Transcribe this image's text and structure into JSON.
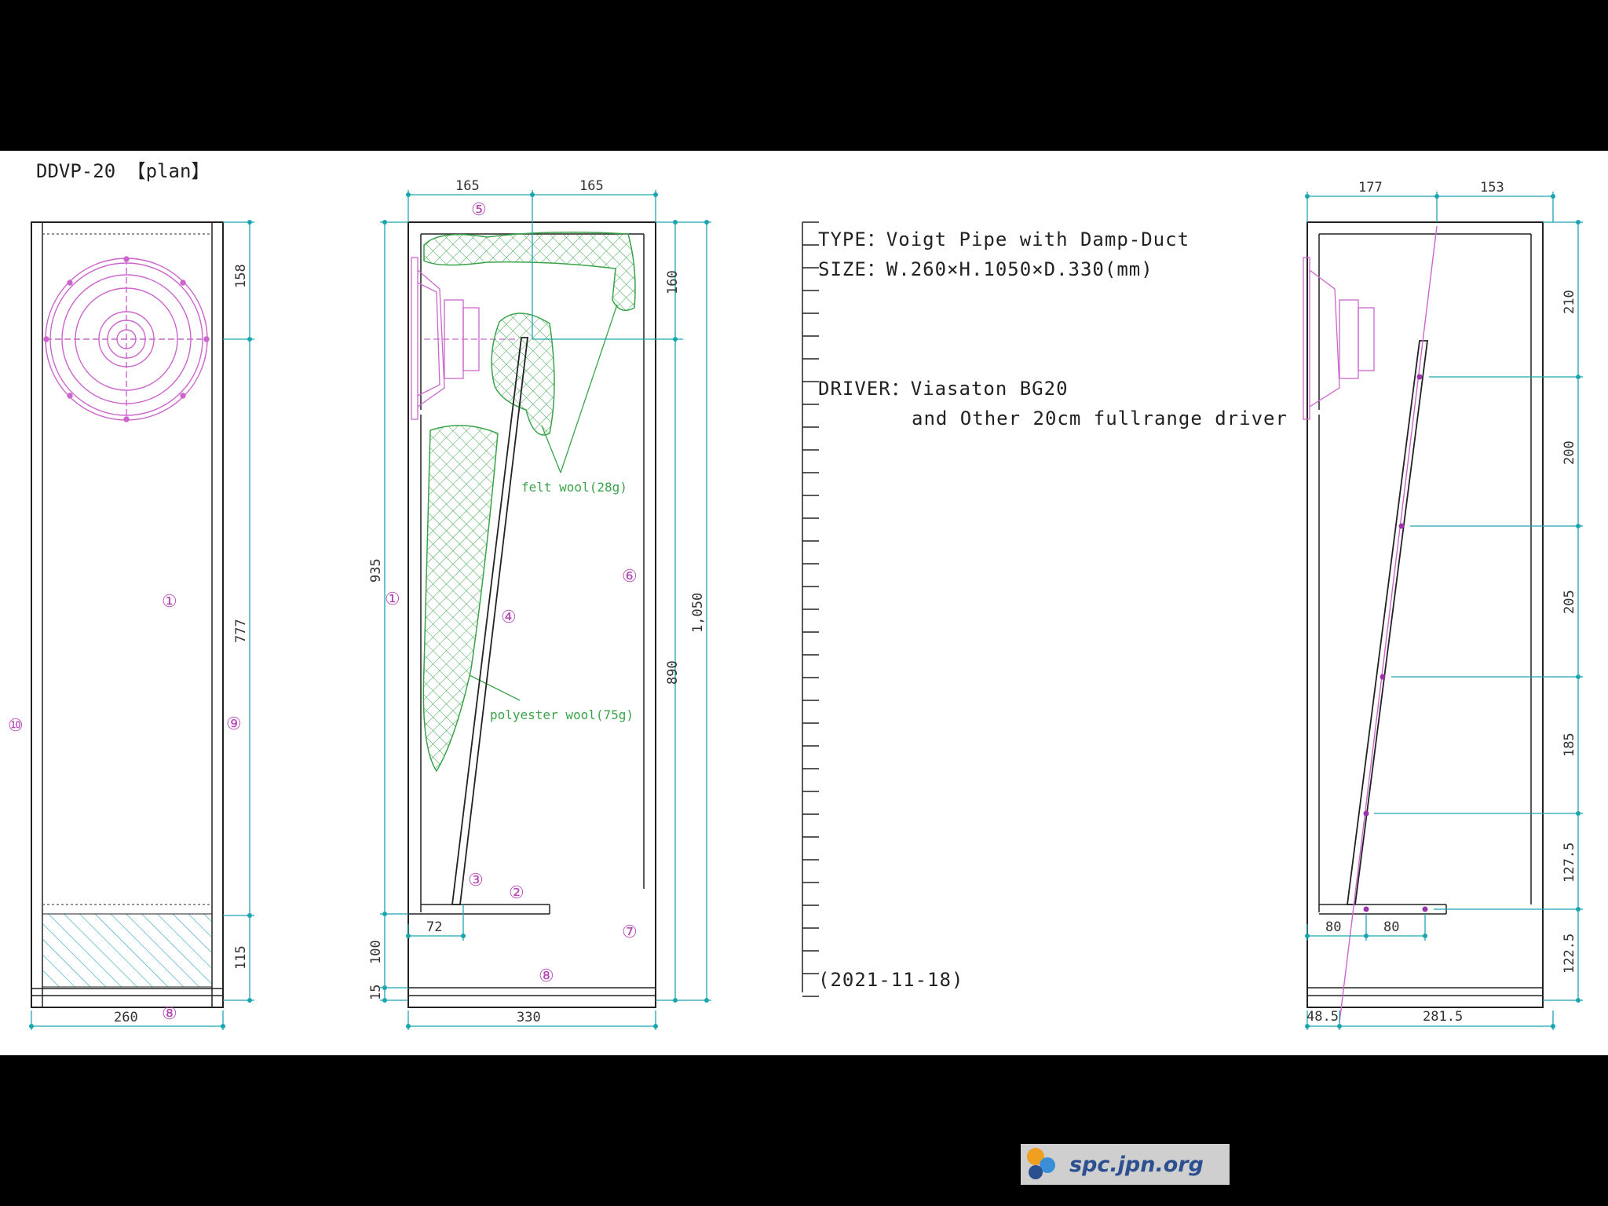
{
  "title": "DDVP-20 【plan】",
  "front_view": {
    "dim_width": "260",
    "dim_heights": [
      "158",
      "777",
      "115"
    ],
    "callouts": [
      "①",
      "⑧",
      "⑨",
      "⑩"
    ]
  },
  "section_view": {
    "dim_top": [
      "165",
      "165"
    ],
    "dim_left": [
      "935",
      "100",
      "15"
    ],
    "dim_right": [
      "160",
      "890"
    ],
    "dim_total": "1,050",
    "dim_bottom": "330",
    "dim_duct": "72",
    "callouts": [
      "①",
      "②",
      "③",
      "④",
      "⑤",
      "⑥",
      "⑦",
      "⑧"
    ],
    "felt_label": "felt wool(28g)",
    "poly_label": "polyester wool(75g)"
  },
  "specs": {
    "type": "TYPE：Voigt Pipe with Damp-Duct",
    "size": "SIZE：W.260×H.1050×D.330(mm)",
    "driver": "DRIVER：Viasaton BG20",
    "driver2": "and Other 20cm fullrange driver",
    "date": "(2021-11-18)"
  },
  "side_view": {
    "dim_top": [
      "177",
      "153"
    ],
    "dim_right": [
      "210",
      "200",
      "205",
      "185",
      "127.5",
      "122.5"
    ],
    "dim_bottom_small": [
      "80",
      "80"
    ],
    "dim_bottom": [
      "48.5",
      "281.5"
    ]
  },
  "logo": {
    "text": "spc.jpn.org"
  },
  "colors": {
    "dimension": "#1aa6b0",
    "driver": "#cc66cc",
    "wool": "#3aa34a",
    "lines": "#222222"
  }
}
